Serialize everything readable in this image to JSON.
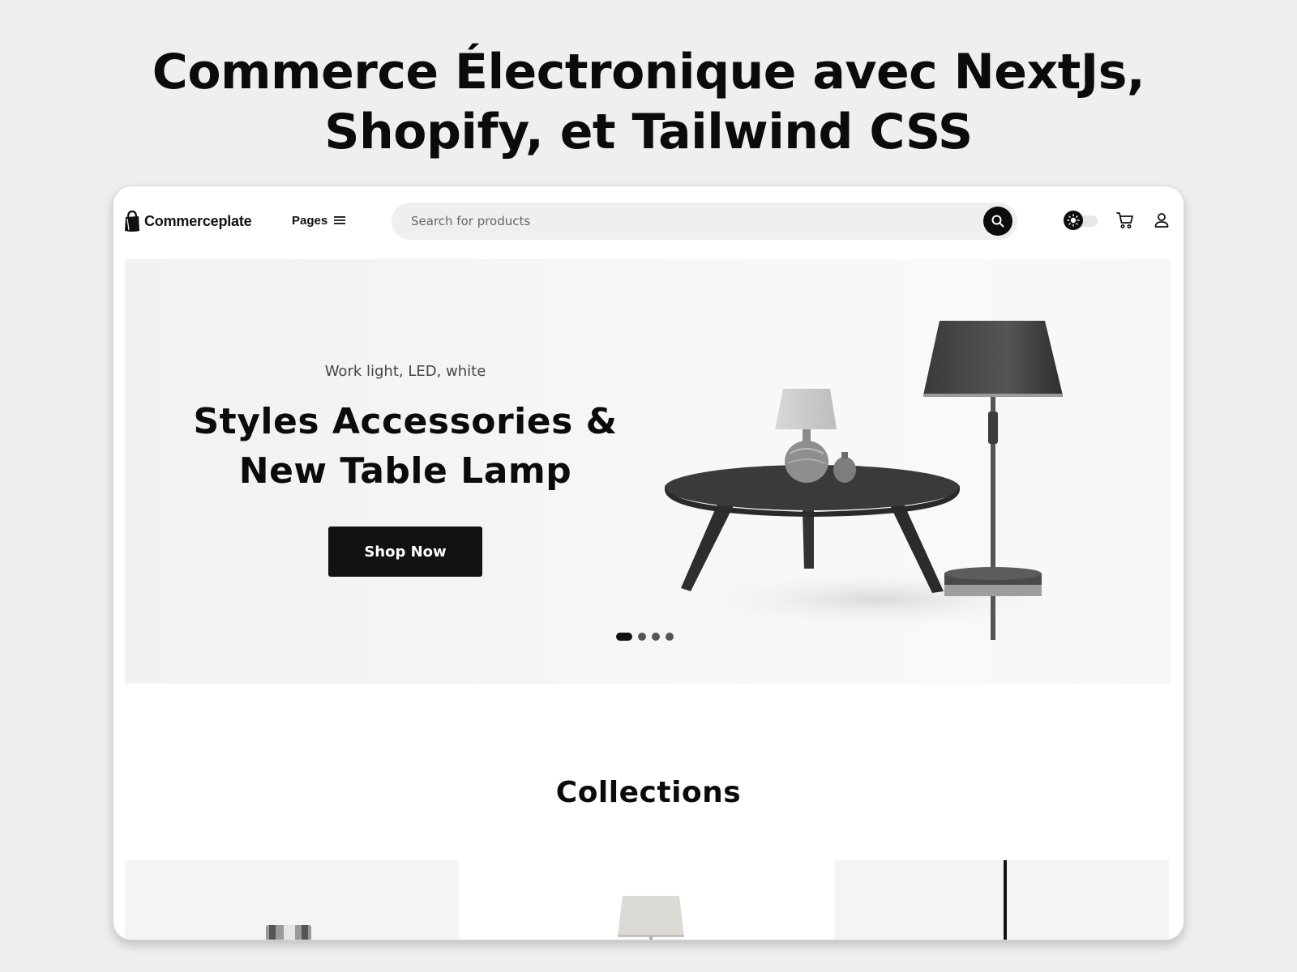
{
  "page": {
    "headline_line1": "Commerce Électronique avec NextJs,",
    "headline_line2": "Shopify, et Tailwind CSS"
  },
  "header": {
    "logo_text": "Commerceplate",
    "pages_label": "Pages",
    "search_placeholder": "Search for products",
    "icons": [
      "bag-logo-icon",
      "hamburger-menu-icon",
      "search-icon",
      "sun-icon",
      "cart-icon",
      "user-icon"
    ]
  },
  "hero": {
    "subtitle": "Work light, LED, white",
    "title_line1": "Styles Accessories &",
    "title_line2": "New Table Lamp",
    "cta_label": "Shop Now",
    "slides_count": 4,
    "active_slide": 1
  },
  "collections": {
    "title": "Collections"
  },
  "colors": {
    "background": "#efefef",
    "primary": "#121212",
    "surface": "#ffffff",
    "search_bg": "#efefef"
  }
}
